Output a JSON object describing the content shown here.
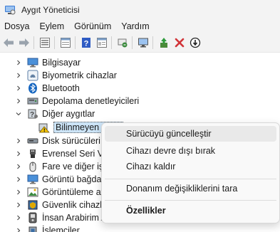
{
  "window": {
    "title": "Aygıt Yöneticisi"
  },
  "menu": [
    "Dosya",
    "Eylem",
    "Görünüm",
    "Yardım"
  ],
  "toolbar": {
    "icons": [
      "back-arrow-icon",
      "forward-arrow-icon",
      "properties-grid-icon",
      "details-pane-icon",
      "help-icon",
      "details-icon",
      "scan-hardware-icon",
      "monitor-icon",
      "update-driver-icon",
      "uninstall-x-icon",
      "disable-down-arrow-icon"
    ]
  },
  "tree": {
    "items": [
      {
        "label": "Bilgisayar",
        "icon": "computer-icon",
        "expanded": false
      },
      {
        "label": "Biyometrik cihazlar",
        "icon": "fingerprint-icon",
        "expanded": false
      },
      {
        "label": "Bluetooth",
        "icon": "bluetooth-icon",
        "expanded": false
      },
      {
        "label": "Depolama denetleyicileri",
        "icon": "storage-controller-icon",
        "expanded": false
      },
      {
        "label": "Diğer aygıtlar",
        "icon": "other-devices-icon",
        "expanded": true
      },
      {
        "label": "Bilinmeyen aygıt",
        "icon": "unknown-device-warning-icon",
        "child": true,
        "selected": true
      },
      {
        "label": "Disk sürücüleri",
        "icon": "disk-drive-icon",
        "expanded": false
      },
      {
        "label": "Evrensel Seri Veri",
        "icon": "usb-icon",
        "expanded": false
      },
      {
        "label": "Fare ve diğer işaret",
        "icon": "mouse-icon",
        "expanded": false
      },
      {
        "label": "Görüntü bağdaştırıcıları",
        "icon": "display-adapter-icon",
        "expanded": false
      },
      {
        "label": "Görüntüleme aygıtları",
        "icon": "imaging-device-icon",
        "expanded": false
      },
      {
        "label": "Güvenlik cihazları",
        "icon": "security-device-icon",
        "expanded": false
      },
      {
        "label": "İnsan Arabirim Aygıtları",
        "icon": "hid-icon",
        "expanded": false
      },
      {
        "label": "İşlemciler",
        "icon": "processor-icon",
        "expanded": false
      }
    ]
  },
  "context_menu": {
    "update_driver": "Sürücüyü güncelleştir",
    "disable_device": "Cihazı devre dışı bırak",
    "uninstall_device": "Cihazı kaldır",
    "scan_hardware": "Donanım değişikliklerini tara",
    "properties": "Özellikler"
  },
  "colors": {
    "accent": "#0067c0",
    "error_red": "#d13438",
    "warning_yellow": "#f2c200",
    "selection": "#cce4f7"
  }
}
